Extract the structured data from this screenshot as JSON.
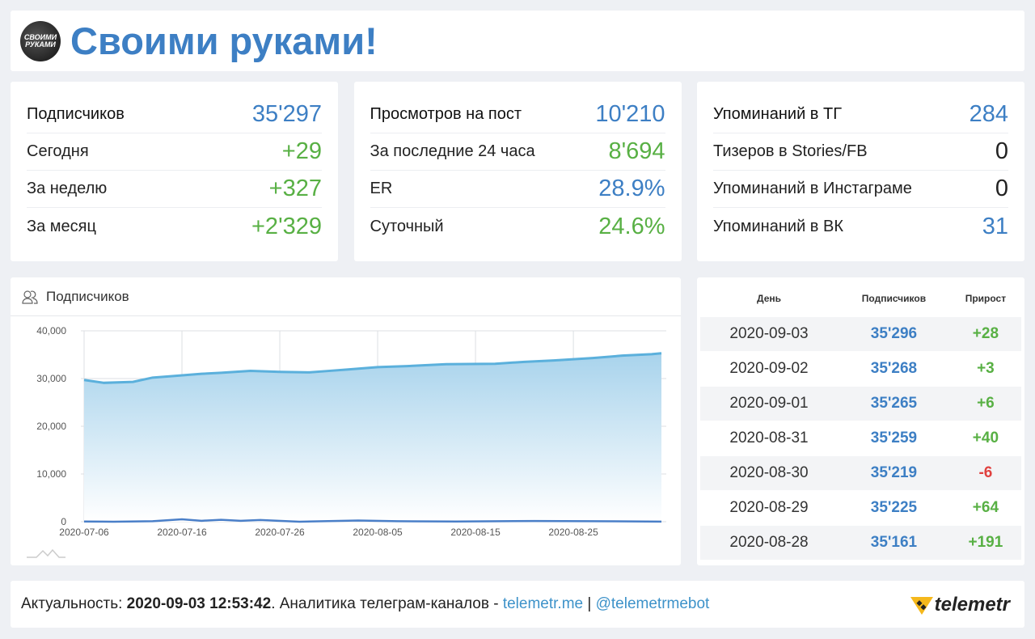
{
  "header": {
    "title": "Своими руками!",
    "avatar_text": "СВОИМИ РУКАМИ"
  },
  "stats": [
    {
      "rows": [
        {
          "label": "Подписчиков",
          "value": "35'297",
          "color": "blue"
        },
        {
          "label": "Сегодня",
          "value": "+29",
          "color": "green"
        },
        {
          "label": "За неделю",
          "value": "+327",
          "color": "green"
        },
        {
          "label": "За месяц",
          "value": "+2'329",
          "color": "green"
        }
      ]
    },
    {
      "rows": [
        {
          "label": "Просмотров на пост",
          "value": "10'210",
          "color": "blue"
        },
        {
          "label": "За последние 24 часа",
          "value": "8'694",
          "color": "green"
        },
        {
          "label": "ER",
          "value": "28.9%",
          "color": "blue"
        },
        {
          "label": "Суточный",
          "value": "24.6%",
          "color": "green"
        }
      ]
    },
    {
      "rows": [
        {
          "label": "Упоминаний в ТГ",
          "value": "284",
          "color": "blue"
        },
        {
          "label": "Тизеров в Stories/FB",
          "value": "0",
          "color": "dark"
        },
        {
          "label": "Упоминаний в Инстаграме",
          "value": "0",
          "color": "dark"
        },
        {
          "label": "Упоминаний в ВК",
          "value": "31",
          "color": "blue"
        }
      ]
    }
  ],
  "chart_title": "Подписчиков",
  "chart_data": {
    "type": "area",
    "title": "Подписчиков",
    "ylim": [
      0,
      40000
    ],
    "yticks": [
      "40,000",
      "30,000",
      "20,000",
      "10,000",
      "0"
    ],
    "xticks": [
      "2020-07-06",
      "2020-07-16",
      "2020-07-26",
      "2020-08-05",
      "2020-08-15",
      "2020-08-25"
    ],
    "x_start": "2020-07-06",
    "x_end": "2020-09-03",
    "series": [
      {
        "name": "Подписчиков",
        "days": [
          0,
          2,
          5,
          7,
          9,
          12,
          14,
          17,
          20,
          23,
          25,
          27,
          30,
          33,
          37,
          42,
          45,
          48,
          52,
          55,
          58,
          59
        ],
        "values": [
          29700,
          29100,
          29300,
          30200,
          30500,
          31000,
          31200,
          31600,
          31400,
          31300,
          31600,
          31900,
          32400,
          32600,
          33000,
          33100,
          33500,
          33800,
          34300,
          34800,
          35100,
          35297
        ]
      },
      {
        "name": "Прирост",
        "days": [
          0,
          3,
          7,
          10,
          12,
          14,
          16,
          18,
          22,
          28,
          32,
          38,
          46,
          52,
          59
        ],
        "values": [
          50,
          0,
          100,
          500,
          200,
          400,
          200,
          350,
          0,
          250,
          100,
          50,
          150,
          100,
          28
        ]
      }
    ]
  },
  "table": {
    "headers": [
      "День",
      "Подписчиков",
      "Прирост"
    ],
    "rows": [
      [
        "2020-09-03",
        "35'296",
        "+28"
      ],
      [
        "2020-09-02",
        "35'268",
        "+3"
      ],
      [
        "2020-09-01",
        "35'265",
        "+6"
      ],
      [
        "2020-08-31",
        "35'259",
        "+40"
      ],
      [
        "2020-08-30",
        "35'219",
        "-6"
      ],
      [
        "2020-08-29",
        "35'225",
        "+64"
      ],
      [
        "2020-08-28",
        "35'161",
        "+191"
      ]
    ]
  },
  "footer": {
    "prefix": "Актуальность: ",
    "timestamp": "2020-09-03 12:53:42",
    "middle": ". Аналитика телеграм-каналов - ",
    "link1": "telemetr.me",
    "sep": " | ",
    "link2": "@telemetrmebot",
    "logo": "telemetr"
  },
  "colors": {
    "blue": "#3d7fc4",
    "green": "#58b044",
    "red": "#e0413f"
  }
}
